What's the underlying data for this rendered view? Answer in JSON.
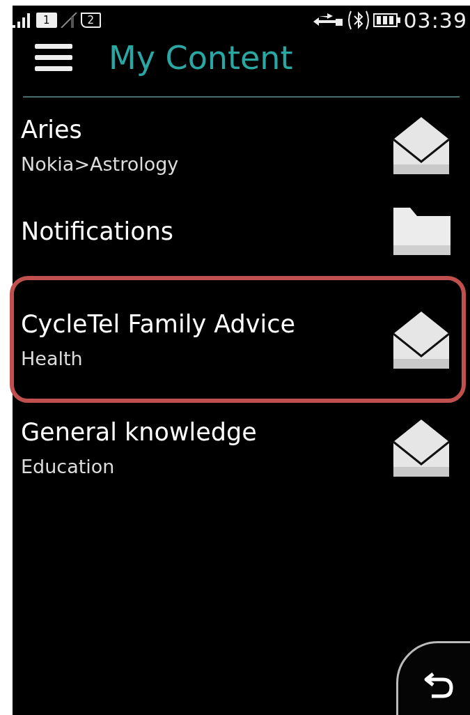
{
  "status_bar": {
    "sim_1": "1",
    "sim_2": "2",
    "time": "03:39"
  },
  "header": {
    "title": "My Content"
  },
  "items": [
    {
      "title": "Aries",
      "subtitle": "Nokia>Astrology",
      "kind": "message",
      "highlighted": false
    },
    {
      "title": "Notifications",
      "kind": "folder",
      "highlighted": false
    },
    {
      "title": "CycleTel Family Advice",
      "subtitle": "Health",
      "kind": "message",
      "highlighted": true
    },
    {
      "title": "General knowledge",
      "subtitle": "Education",
      "kind": "message",
      "highlighted": false
    }
  ]
}
